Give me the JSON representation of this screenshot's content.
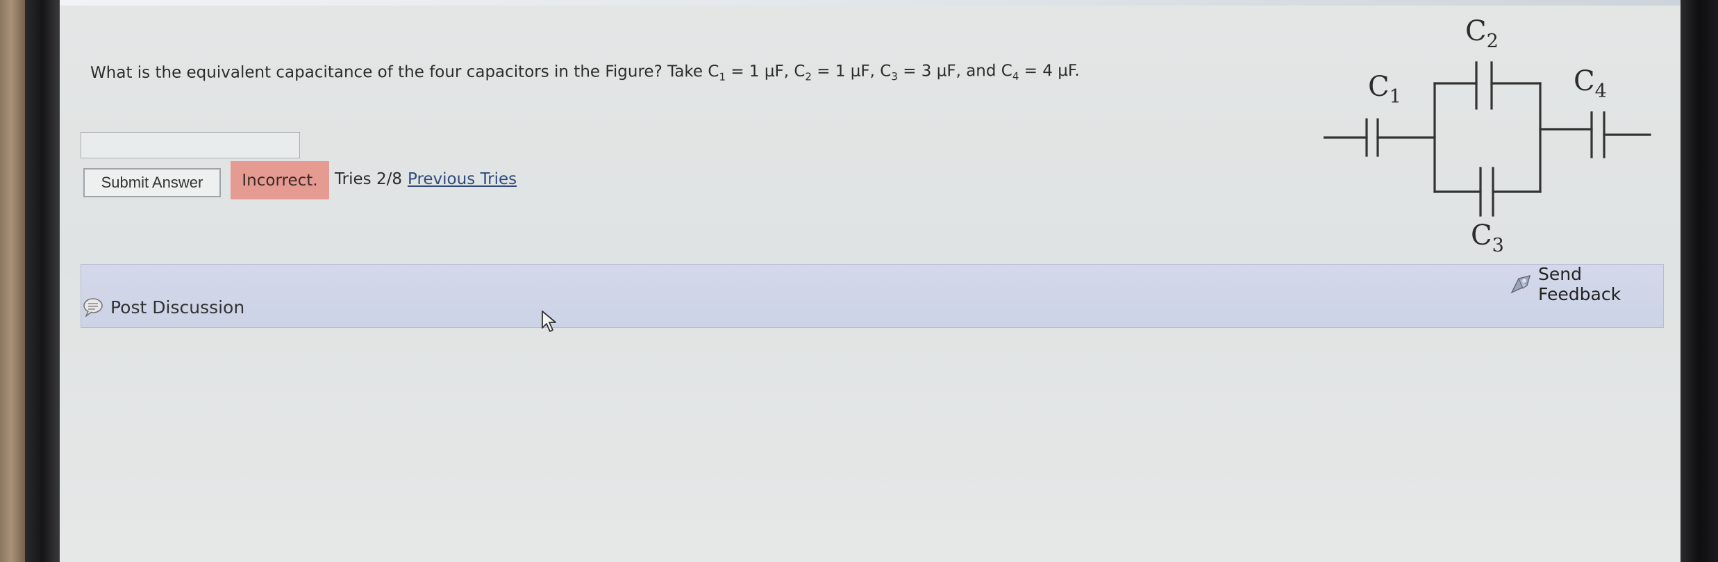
{
  "question": {
    "prefix": "What is the equivalent capacitance of the four capacitors in the Figure? Take C",
    "c1_sub": "1",
    "c1_val": " = 1 μF, C",
    "c2_sub": "2",
    "c2_val": " = 1 μF, C",
    "c3_sub": "3",
    "c3_val": " = 3 μF, and C",
    "c4_sub": "4",
    "c4_val": " = 4 μF."
  },
  "answer": {
    "value": "",
    "placeholder": ""
  },
  "submit": {
    "label": "Submit Answer"
  },
  "status": {
    "label": "Incorrect.",
    "color": "#e59a92"
  },
  "tries": {
    "count": "Tries 2/8",
    "previous_link": "Previous Tries"
  },
  "discussion": {
    "post_label": "Post Discussion",
    "post_icon": "chat-bubble-icon",
    "feedback_label": "Send Feedback",
    "feedback_icon": "feedback-icon"
  },
  "figure": {
    "c1": {
      "letter": "C",
      "sub": "1"
    },
    "c2": {
      "letter": "C",
      "sub": "2"
    },
    "c3": {
      "letter": "C",
      "sub": "3"
    },
    "c4": {
      "letter": "C",
      "sub": "4"
    }
  },
  "colors": {
    "screen_bg": "#e2e5e5",
    "discussion_bar": "#cfd6e8",
    "link": "#2f4a7a"
  }
}
